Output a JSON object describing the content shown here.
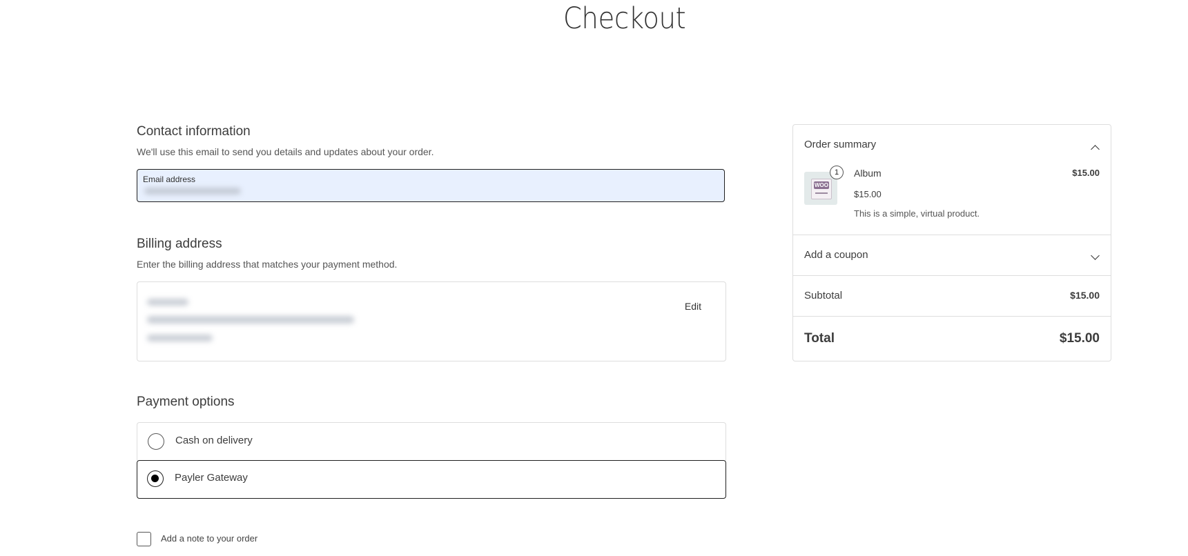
{
  "page": {
    "title": "Checkout"
  },
  "contact": {
    "title": "Contact information",
    "description": "We'll use this email to send you details and updates about your order.",
    "email_label": "Email address"
  },
  "billing": {
    "title": "Billing address",
    "description": "Enter the billing address that matches your payment method.",
    "edit_label": "Edit"
  },
  "payment": {
    "title": "Payment options",
    "options": [
      {
        "label": "Cash on delivery",
        "selected": false
      },
      {
        "label": "Payler Gateway",
        "selected": true
      }
    ]
  },
  "note": {
    "label": "Add a note to your order"
  },
  "summary": {
    "title": "Order summary",
    "item": {
      "quantity": "1",
      "name": "Album",
      "line_total": "$15.00",
      "price": "$15.00",
      "description": "This is a simple, virtual product.",
      "thumbnail_text": "WOO"
    },
    "coupon_label": "Add a coupon",
    "subtotal_label": "Subtotal",
    "subtotal_value": "$15.00",
    "total_label": "Total",
    "total_value": "$15.00"
  },
  "colors": {
    "selected_border": "#1e1e1e",
    "email_fill": "#e8f0fe",
    "border": "#dddddd"
  }
}
